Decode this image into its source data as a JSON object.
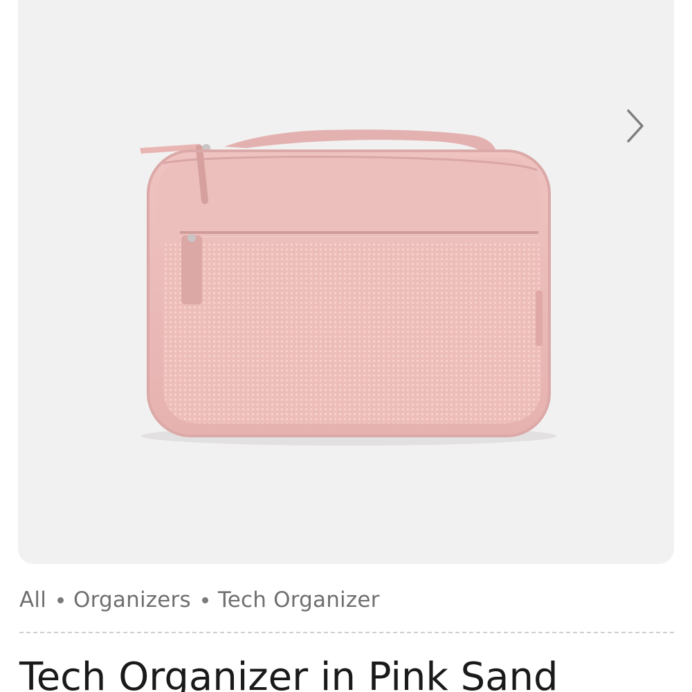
{
  "product": {
    "title": "Tech Organizer in Pink Sand",
    "image_alt": "Tech Organizer in Pink Sand",
    "color": "#e8b9b8"
  },
  "gallery": {
    "next_icon": "chevron-right-icon",
    "background": "#f2f1f2"
  },
  "breadcrumb": {
    "items": [
      "All",
      "Organizers",
      "Tech Organizer"
    ],
    "separator_icon": "dot-icon"
  }
}
